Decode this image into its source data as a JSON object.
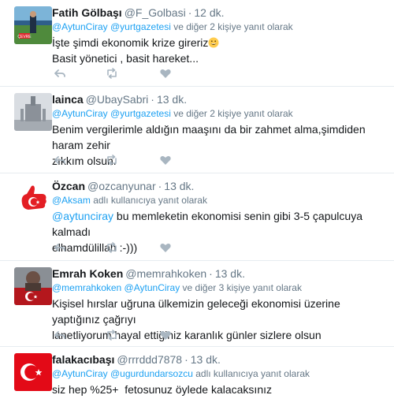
{
  "icons": {
    "reply": "reply-icon",
    "retweet": "retweet-icon",
    "like": "heart-icon"
  },
  "colors": {
    "link": "#1da1f2",
    "muted": "#657786",
    "divider": "#e6ecf0"
  },
  "tweets": [
    {
      "name": "Fatih Gölbaşı",
      "handle": "@F_Golbasi",
      "time": "12 dk.",
      "reply_users": "@AytunCiray @yurtgazetesi",
      "reply_suffix": "ve diğer 2 kişiye yanıt olarak",
      "line1": "İşte şimdi ekonomik krize gireriz",
      "line2": "Basit yönetici , basit hareket...",
      "emoji": "grinning-face"
    },
    {
      "name": "lainca",
      "handle": "@UbaySabri",
      "time": "13 dk.",
      "reply_users": "@AytunCiray @yurtgazetesi",
      "reply_suffix": "ve diğer 2 kişiye yanıt olarak",
      "line1": "Benim vergilerimle aldığın maaşını da bir zahmet alma,şimdiden haram zehir",
      "line2": "zıkkım olsun."
    },
    {
      "name": "Özcan",
      "handle": "@ozcanyunar",
      "time": "13 dk.",
      "reply_users": "@Aksam",
      "reply_suffix": "adlı kullanıcıya yanıt olarak",
      "mention": "@aytunciray",
      "line1": " bu memleketin ekonomisi senin gibi 3-5 çapulcuya kalmadı",
      "line2": "elhamdülillah :-)))"
    },
    {
      "name": "Emrah Koken",
      "handle": "@memrahkoken",
      "time": "13 dk.",
      "reply_users": "@memrahkoken @AytunCiray",
      "reply_suffix": "ve diğer 3 kişiye yanıt olarak",
      "line1": "Kişisel hırslar uğruna ülkemizin geleceği ekonomisi üzerine yaptığınız çağrıyı",
      "line2": "lanetliyorum.hayal ettiğiniz karanlık günler sizlere olsun"
    },
    {
      "name": "falakacıbaşı",
      "handle": "@rrrddd7878",
      "time": "13 dk.",
      "reply_users": "@AytunCiray @ugurdundarsozcu",
      "reply_suffix": "adlı kullanıcıya yanıt olarak",
      "line1": "siz hep %25+  fetosunuz öylede kalacaksınız"
    }
  ]
}
